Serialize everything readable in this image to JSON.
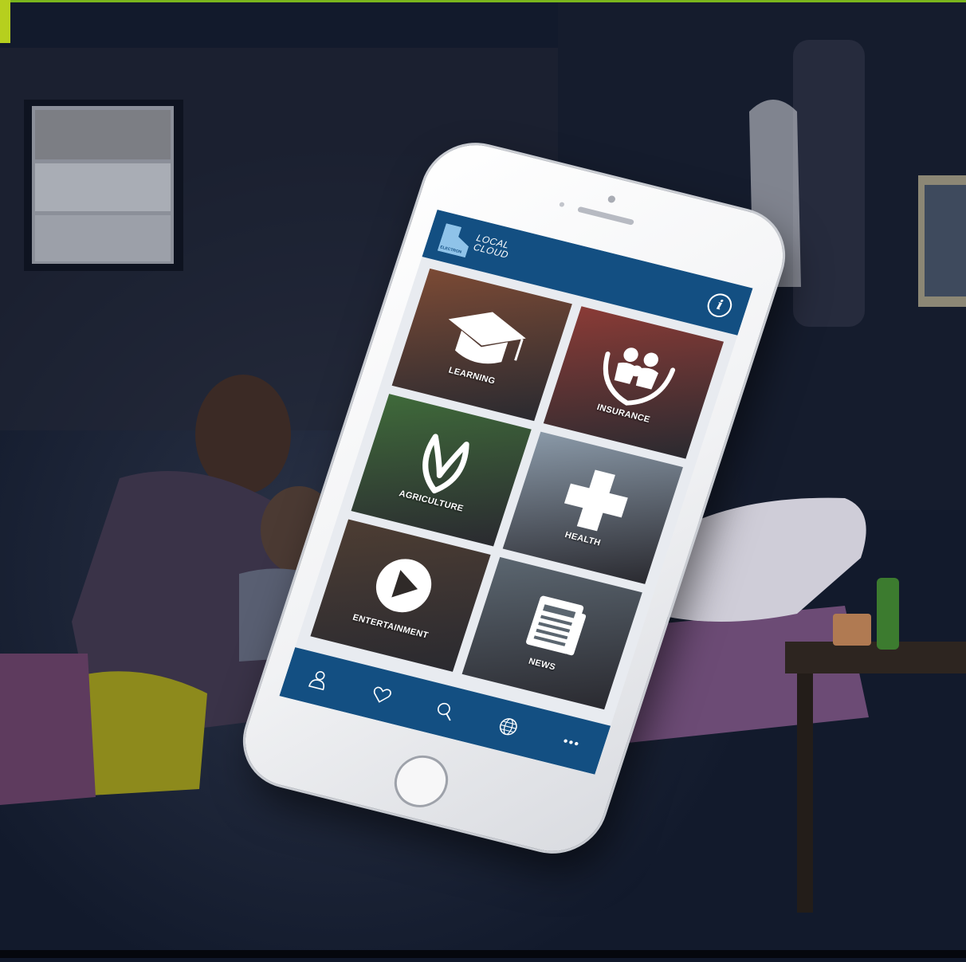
{
  "app": {
    "logo_text_line1": "LOCAL",
    "logo_text_line2": "CLOUD",
    "logo_subtext": "ELECTRON"
  },
  "header": {
    "info_label": "i"
  },
  "tiles": [
    {
      "label": "LEARNING",
      "icon": "graduation-cap-icon",
      "tint": "#7b4a35"
    },
    {
      "label": "INSURANCE",
      "icon": "family-protection-icon",
      "tint": "#8a3b36"
    },
    {
      "label": "AGRICULTURE",
      "icon": "leaf-sprout-icon",
      "tint": "#3f6a3a"
    },
    {
      "label": "HEALTH",
      "icon": "medical-cross-icon",
      "tint": "#8a99a8"
    },
    {
      "label": "ENTERTAINMENT",
      "icon": "play-icon",
      "tint": "#4d3d33"
    },
    {
      "label": "NEWS",
      "icon": "newspaper-icon",
      "tint": "#5b6670"
    }
  ],
  "tab_bar": [
    {
      "icon": "user-icon"
    },
    {
      "icon": "heart-icon"
    },
    {
      "icon": "search-icon"
    },
    {
      "icon": "globe-icon"
    },
    {
      "icon": "more-icon"
    }
  ],
  "colors": {
    "brand_blue": "#134f82",
    "accent_green": "#7ab51d",
    "corner_tab": "#b6cf1e"
  }
}
